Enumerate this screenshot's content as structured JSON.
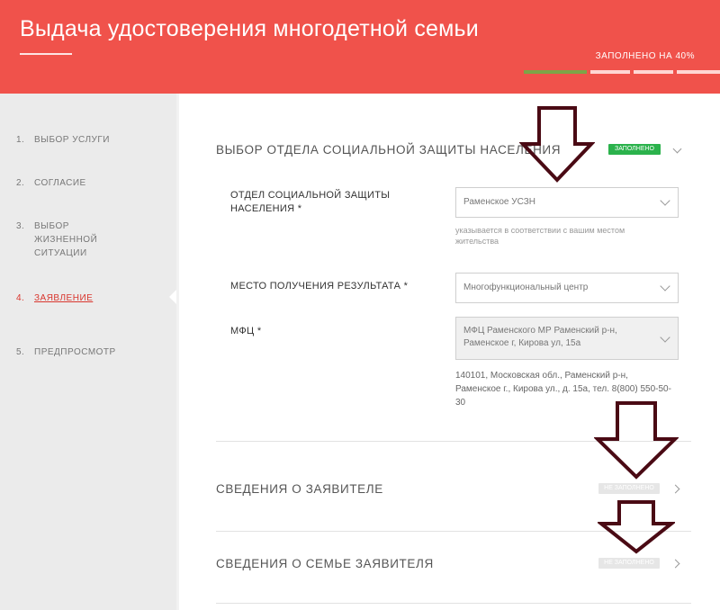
{
  "header": {
    "title": "Выдача удостоверения многодетной семьи",
    "progress_label": "ЗАПОЛНЕНО НА 40%",
    "progress": 0.4
  },
  "sidebar": {
    "items": [
      {
        "num": "1.",
        "label": "Выбор услуги"
      },
      {
        "num": "2.",
        "label": "Согласие"
      },
      {
        "num": "3.",
        "label": "Выбор жизненной ситуации"
      },
      {
        "num": "4.",
        "label": "Заявление"
      },
      {
        "num": "5.",
        "label": "Предпросмотр"
      }
    ]
  },
  "sections": {
    "department": {
      "title": "ВЫБОР ОТДЕЛА СОЦИАЛЬНОЙ ЗАЩИТЫ НАСЕЛЕНИЯ",
      "badge": "ЗАПОЛНЕНО",
      "fields": {
        "department_label": "ОТДЕЛ СОЦИАЛЬНОЙ ЗАЩИТЫ НАСЕЛЕНИЯ",
        "department_value": "Раменское УСЗН",
        "department_hint": "указывается в соответствии с вашим местом жительства",
        "place_label": "МЕСТО ПОЛУЧЕНИЯ РЕЗУЛЬТАТА",
        "place_value": "Многофункциональный центр",
        "mfc_label": "МФЦ",
        "mfc_value": "МФЦ Раменского МР Раменский р-н, Раменское г, Кирова ул, 15а",
        "mfc_address": "140101, Московская обл., Раменский р-н, Раменское г., Кирова ул., д. 15а, тел. 8(800) 550-50-30",
        "required_mark": "*"
      }
    },
    "applicant": {
      "title": "СВЕДЕНИЯ О ЗАЯВИТЕЛЕ",
      "badge": "НЕ ЗАПОЛНЕНО"
    },
    "family": {
      "title": "СВЕДЕНИЯ О СЕМЬЕ ЗАЯВИТЕЛЯ",
      "badge": "НЕ ЗАПОЛНЕНО"
    }
  },
  "colors": {
    "header_bg": "#f0524b",
    "active_step": "#d9362e",
    "filled_badge": "#2bb24c",
    "progress_done": "#7da447"
  }
}
